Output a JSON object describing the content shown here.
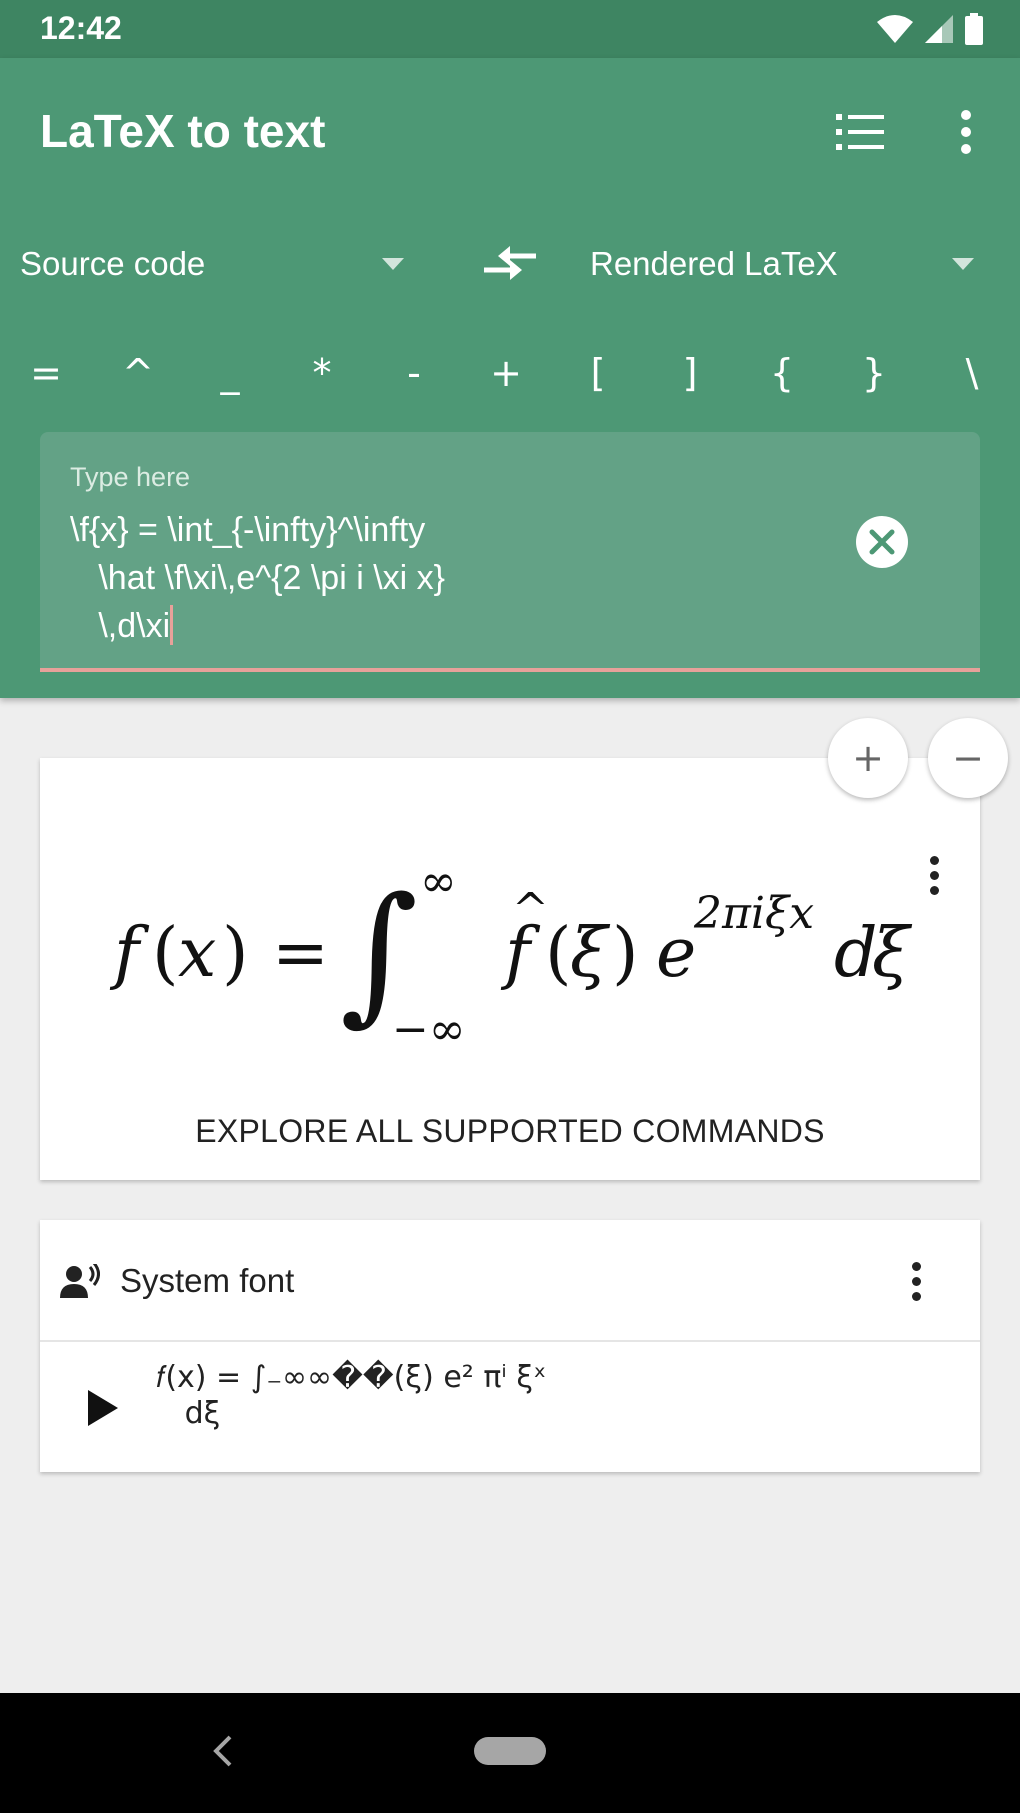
{
  "status": {
    "time": "12:42"
  },
  "app": {
    "title": "LaTeX to text"
  },
  "icons": {
    "list": "format-list-icon",
    "more": "more-vert-icon",
    "swap": "swap-horiz-icon",
    "clear": "cancel-icon",
    "speaker": "record-voice-icon",
    "play": "play-arrow-icon"
  },
  "languages": {
    "source": "Source code",
    "target": "Rendered LaTeX"
  },
  "symbols": [
    "=",
    "^",
    "_",
    "*",
    "-",
    "+",
    "[",
    "]",
    "{",
    "}",
    "\\"
  ],
  "input": {
    "label": "Type here",
    "lines": [
      "\\f{x} = \\int_{-\\infty}^\\infty",
      "   \\hat \\f\\xi\\,e^{2 \\pi i \\xi x}",
      "   \\,d\\xi"
    ]
  },
  "zoom": {
    "in": "+",
    "out": "−"
  },
  "rendered": {
    "lhs": "f",
    "lparen": "(",
    "x": "x",
    "rparen": ")",
    "equals": "=",
    "integral": "∫",
    "upper": "∞",
    "lower": "−∞",
    "fhat": "f",
    "hat": "^",
    "xi": "ξ",
    "e": "e",
    "exp": "2πiξx",
    "d": "d",
    "xi2": "ξ"
  },
  "explore": {
    "label": "EXPLORE ALL SUPPORTED COMMANDS"
  },
  "output": {
    "font": "System font",
    "lines": [
      "𝑓(x) = ∫₋∞∞��(ξ) e² πⁱ ξˣ",
      "   dξ"
    ]
  },
  "colors": {
    "status_bar": "#3e8562",
    "header": "#4d9875",
    "input_bg": "#63a286",
    "accent_underline": "#e8a19a",
    "background": "#eeeeee"
  }
}
